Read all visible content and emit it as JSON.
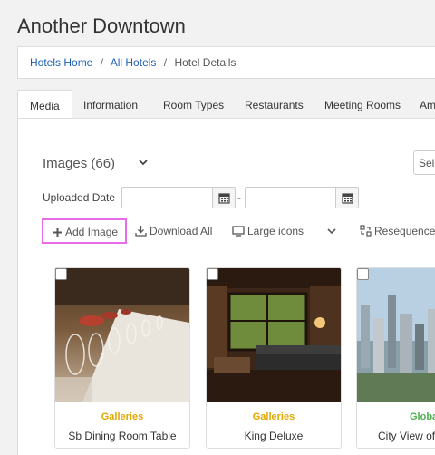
{
  "page": {
    "title": "Another Downtown"
  },
  "breadcrumb": {
    "items": [
      "Hotels Home",
      "All Hotels"
    ],
    "separator": "/",
    "current": "Hotel Details"
  },
  "tabs": [
    "Media",
    "Information",
    "Room Types",
    "Restaurants",
    "Meeting Rooms",
    "Am"
  ],
  "active_tab": "Media",
  "images": {
    "heading": "Images (66)",
    "select_label": "Sele",
    "uploaded_label": "Uploaded Date",
    "date_from": "",
    "date_to": "",
    "dash": "-"
  },
  "toolbar": {
    "add_image": "Add Image",
    "download_all": "Download All",
    "view_mode": "Large icons",
    "resequence": "Resequence"
  },
  "cards": [
    {
      "category": "Galleries",
      "caption": "Sb Dining Room Table",
      "category_color": "#e0a800"
    },
    {
      "category": "Galleries",
      "caption": "King Deluxe",
      "category_color": "#e0a800"
    },
    {
      "category": "Globa",
      "caption": "City View of",
      "category_color": "#4caf50"
    }
  ],
  "colors": {
    "link": "#1f5fb4",
    "highlight": "#e86be8"
  }
}
